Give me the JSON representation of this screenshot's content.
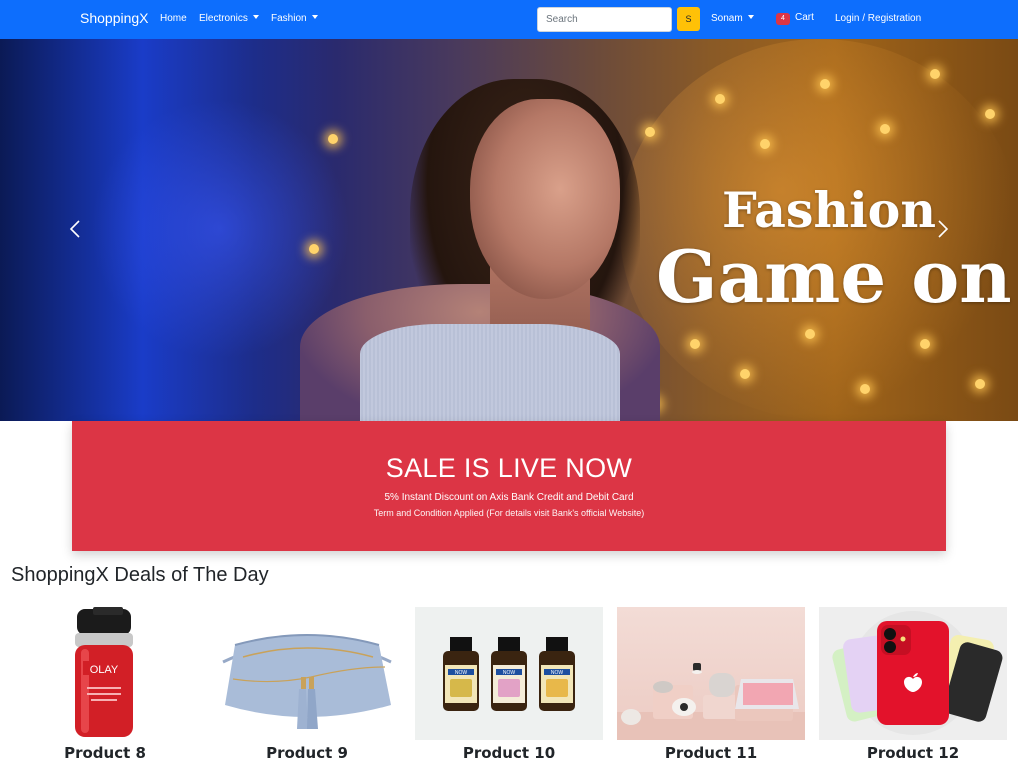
{
  "navbar": {
    "brand": "ShoppingX",
    "links": {
      "home": "Home",
      "electronics": "Electronics",
      "fashion": "Fashion"
    },
    "search": {
      "placeholder": "Search"
    },
    "search_button": "S",
    "user": "Sonam",
    "cart": {
      "count": "4",
      "label": "Cart"
    },
    "login": "Login / Registration",
    "colors": {
      "bar": "#0d6efd",
      "search_button": "#ffc107",
      "badge": "#dc3545"
    }
  },
  "carousel": {
    "line1": "Fashion",
    "line2": "Game on",
    "prev_icon": "chevron-left-icon",
    "next_icon": "chevron-right-icon"
  },
  "sale_banner": {
    "title": "SALE IS LIVE NOW",
    "line1": "5% Instant Discount on Axis Bank Credit and Debit Card",
    "line2": "Term and Condition Applied (For details visit Bank's official Website)",
    "color": "#dc3545"
  },
  "deals": {
    "title": "ShoppingX Deals of The Day",
    "products": [
      {
        "name": "Product 8"
      },
      {
        "name": "Product 9"
      },
      {
        "name": "Product 10",
        "label_a": "NOW"
      },
      {
        "name": "Product 11"
      },
      {
        "name": "Product 12"
      }
    ]
  },
  "product_images": {
    "p8_brand": "OLAY"
  }
}
